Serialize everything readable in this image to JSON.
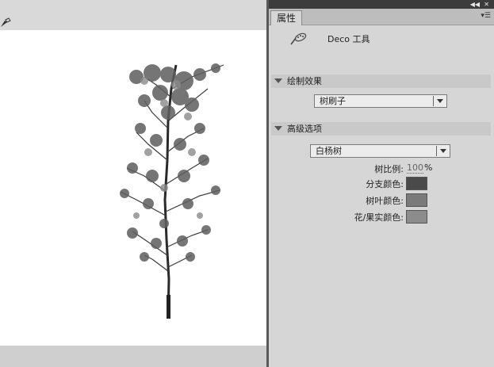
{
  "stage": {
    "canvas_color": "#ffffff"
  },
  "panel": {
    "tab_label": "属性",
    "tool_name": "Deco 工具",
    "drawing_effect": {
      "section_label": "绘制效果",
      "selected": "树刷子"
    },
    "advanced": {
      "section_label": "高级选项",
      "selected": "白杨树",
      "tree_scale_label": "树比例:",
      "tree_scale_value": "100",
      "tree_scale_unit": "%",
      "branch_color_label": "分支颜色:",
      "branch_color": "#4a4a4a",
      "leaf_color_label": "树叶颜色:",
      "leaf_color": "#7a7a7a",
      "fruit_color_label": "花/果实颜色:",
      "fruit_color": "#8c8c8c"
    }
  }
}
